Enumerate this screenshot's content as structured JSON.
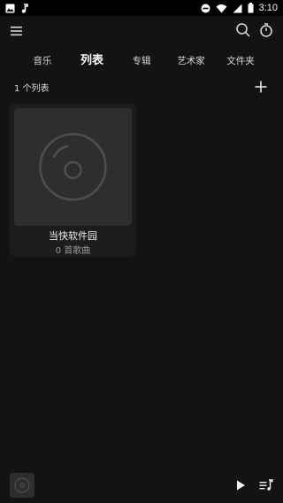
{
  "status_bar": {
    "time": "3:10",
    "left_icons": [
      "image-notification-icon",
      "music-note-notification-icon"
    ],
    "right_icons": [
      "do-not-disturb-icon",
      "wifi-icon",
      "signal-icon",
      "battery-icon"
    ]
  },
  "top_bar": {
    "menu_icon": "menu-icon",
    "search_icon": "search-icon",
    "timer_icon": "timer-icon"
  },
  "tabs": [
    {
      "label": "音乐",
      "active": false
    },
    {
      "label": "列表",
      "active": true
    },
    {
      "label": "专辑",
      "active": false
    },
    {
      "label": "艺术家",
      "active": false
    },
    {
      "label": "文件夹",
      "active": false
    }
  ],
  "list_header": {
    "count_label": "1 个列表",
    "add_icon": "add-icon"
  },
  "playlists": [
    {
      "title": "当快软件园",
      "subtitle": "0 首歌曲",
      "cover_icon": "disc-icon"
    }
  ],
  "player": {
    "cover_icon": "disc-icon",
    "play_icon": "play-icon",
    "queue_icon": "queue-icon"
  },
  "colors": {
    "background": "#131313",
    "card": "#1c1c1c",
    "cover": "#2e2e2e",
    "text_primary": "#ffffff",
    "text_secondary": "#9a9a9a"
  }
}
